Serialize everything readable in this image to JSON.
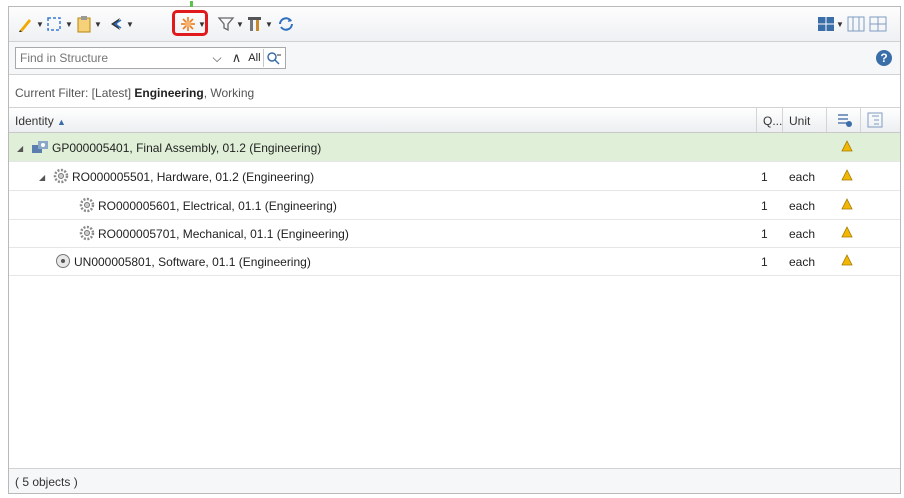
{
  "toolbar": {
    "icons": [
      "edit-pencil-icon",
      "insert-existing-icon",
      "paste-clipboard-icon",
      "back-arrow-icon",
      "new-part-asterisk-icon",
      "filter-funnel-icon",
      "tools-icon",
      "refresh-sync-icon"
    ],
    "highlight_color": "#e0191c"
  },
  "search": {
    "placeholder": "Find in Structure",
    "all_label": "All"
  },
  "filter": {
    "prefix": "Current Filter: [Latest] ",
    "bold": "Engineering",
    "suffix": ", Working"
  },
  "columns": {
    "identity": "Identity",
    "qty": "Q...",
    "unit": "Unit"
  },
  "rows": [
    {
      "label": "GP000005401, Final Assembly, 01.2 (Engineering)",
      "qty": "",
      "unit": "",
      "selected": true
    },
    {
      "label": "RO000005501, Hardware, 01.2 (Engineering)",
      "qty": "1",
      "unit": "each"
    },
    {
      "label": "RO000005601, Electrical, 01.1 (Engineering)",
      "qty": "1",
      "unit": "each"
    },
    {
      "label": "RO000005701, Mechanical, 01.1 (Engineering)",
      "qty": "1",
      "unit": "each"
    },
    {
      "label": "UN000005801, Software, 01.1 (Engineering)",
      "qty": "1",
      "unit": "each"
    }
  ],
  "footer": {
    "count": "( 5 objects )"
  },
  "colors": {
    "selected_row": "#e0f0d8",
    "warning": "#f2b705",
    "accent": "#3a6ea8"
  }
}
